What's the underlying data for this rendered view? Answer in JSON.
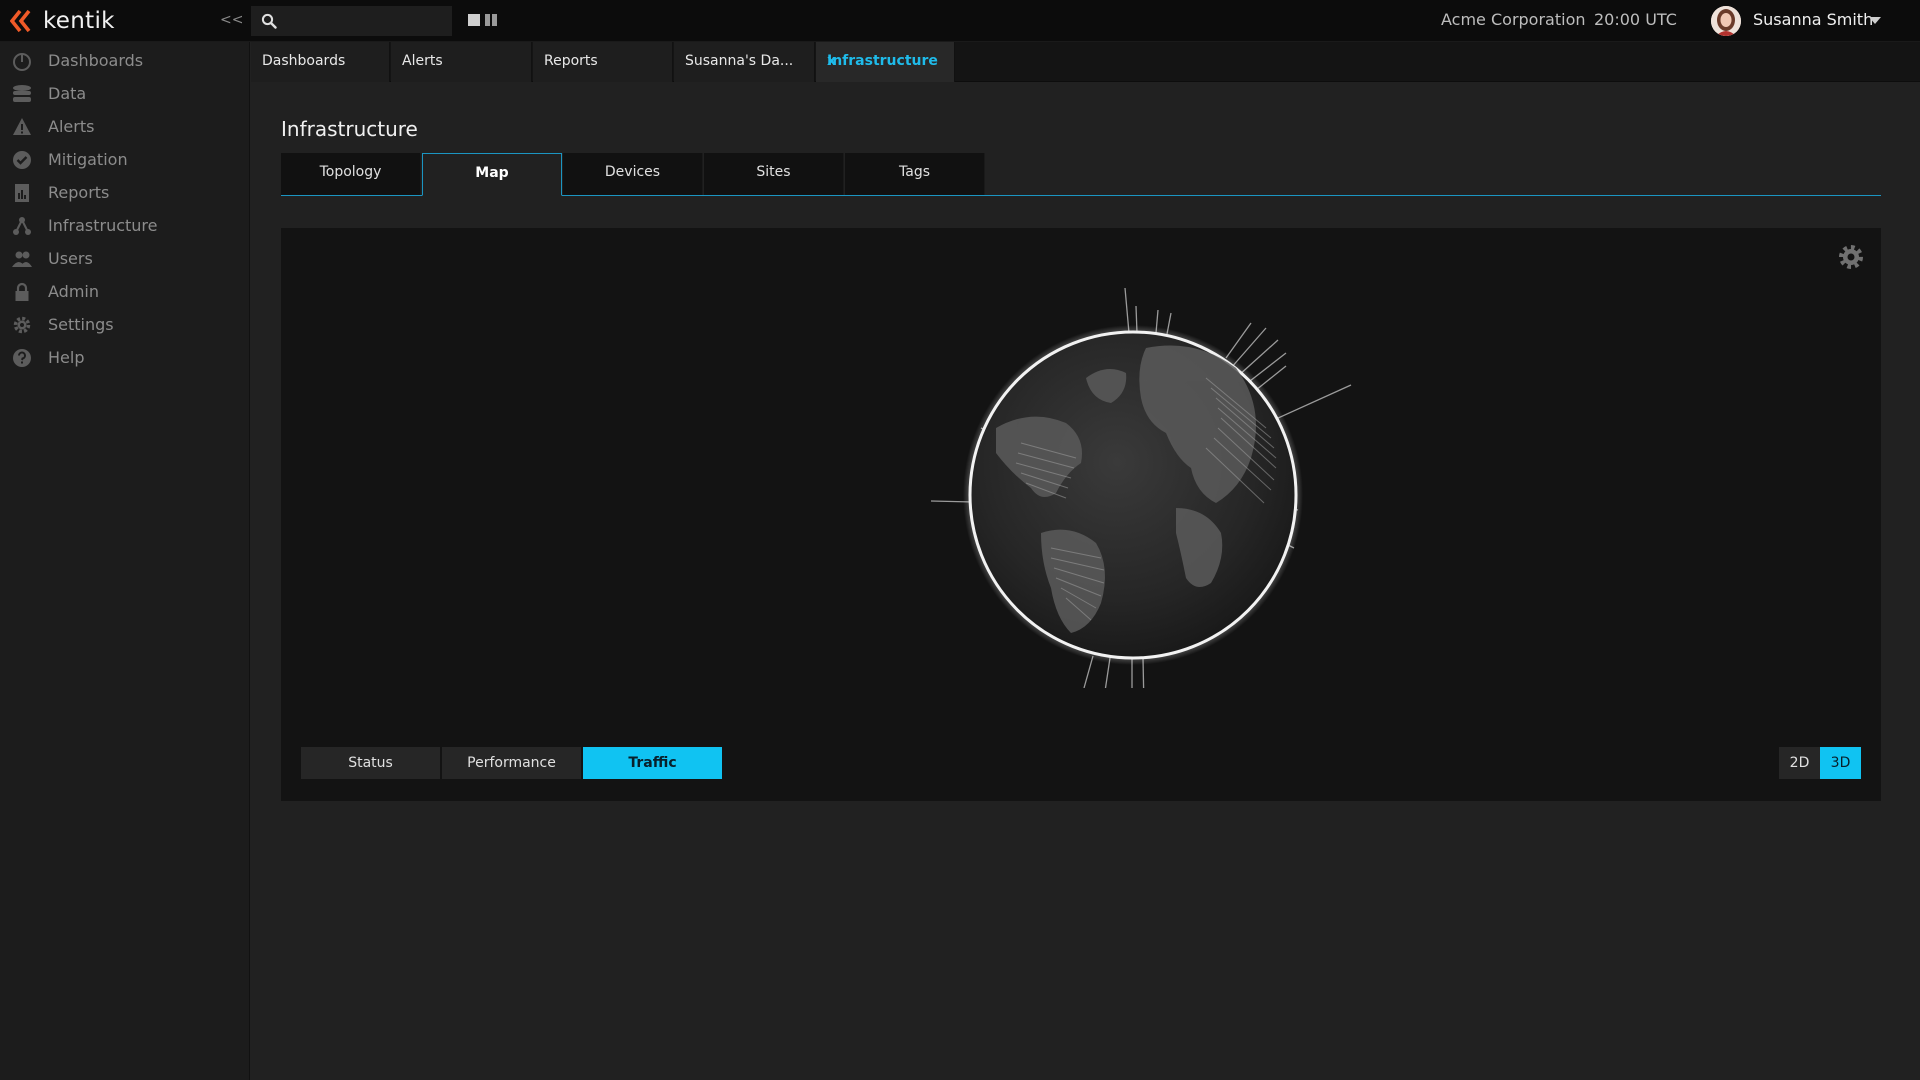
{
  "brand": {
    "name": "kentik",
    "accent_color": "#f05a28",
    "logo_icon": "kentik-chevrons-icon"
  },
  "header": {
    "collapse_label": "<<",
    "search": {
      "value": "",
      "placeholder": ""
    },
    "organization": "Acme Corporation",
    "time": "20:00 UTC",
    "user": {
      "name": "Susanna Smith"
    }
  },
  "sidebar": {
    "items": [
      {
        "label": "Dashboards",
        "icon": "gauge-icon"
      },
      {
        "label": "Data",
        "icon": "database-icon"
      },
      {
        "label": "Alerts",
        "icon": "warning-icon"
      },
      {
        "label": "Mitigation",
        "icon": "check-circle-icon"
      },
      {
        "label": "Reports",
        "icon": "report-icon"
      },
      {
        "label": "Infrastructure",
        "icon": "network-icon"
      },
      {
        "label": "Users",
        "icon": "users-icon"
      },
      {
        "label": "Admin",
        "icon": "lock-icon"
      },
      {
        "label": "Settings",
        "icon": "gear-icon"
      },
      {
        "label": "Help",
        "icon": "help-icon"
      }
    ]
  },
  "tabs": [
    {
      "label": "Dashboards"
    },
    {
      "label": "Alerts"
    },
    {
      "label": "Reports"
    },
    {
      "label": "Susanna's Da..."
    },
    {
      "label": "Infrastructure",
      "active": true,
      "close_label": "x"
    }
  ],
  "main": {
    "title": "Infrastructure",
    "subtabs": [
      {
        "label": "Topology"
      },
      {
        "label": "Map",
        "active": true
      },
      {
        "label": "Devices"
      },
      {
        "label": "Sites"
      },
      {
        "label": "Tags"
      }
    ],
    "map": {
      "modes": [
        {
          "label": "Status"
        },
        {
          "label": "Performance"
        },
        {
          "label": "Traffic",
          "active": true
        }
      ],
      "dimensions": [
        {
          "label": "2D"
        },
        {
          "label": "3D",
          "active": true
        }
      ]
    }
  },
  "colors": {
    "highlight": "#10c3f2",
    "active_tab_text": "#1fbbea",
    "background": "#212121"
  }
}
